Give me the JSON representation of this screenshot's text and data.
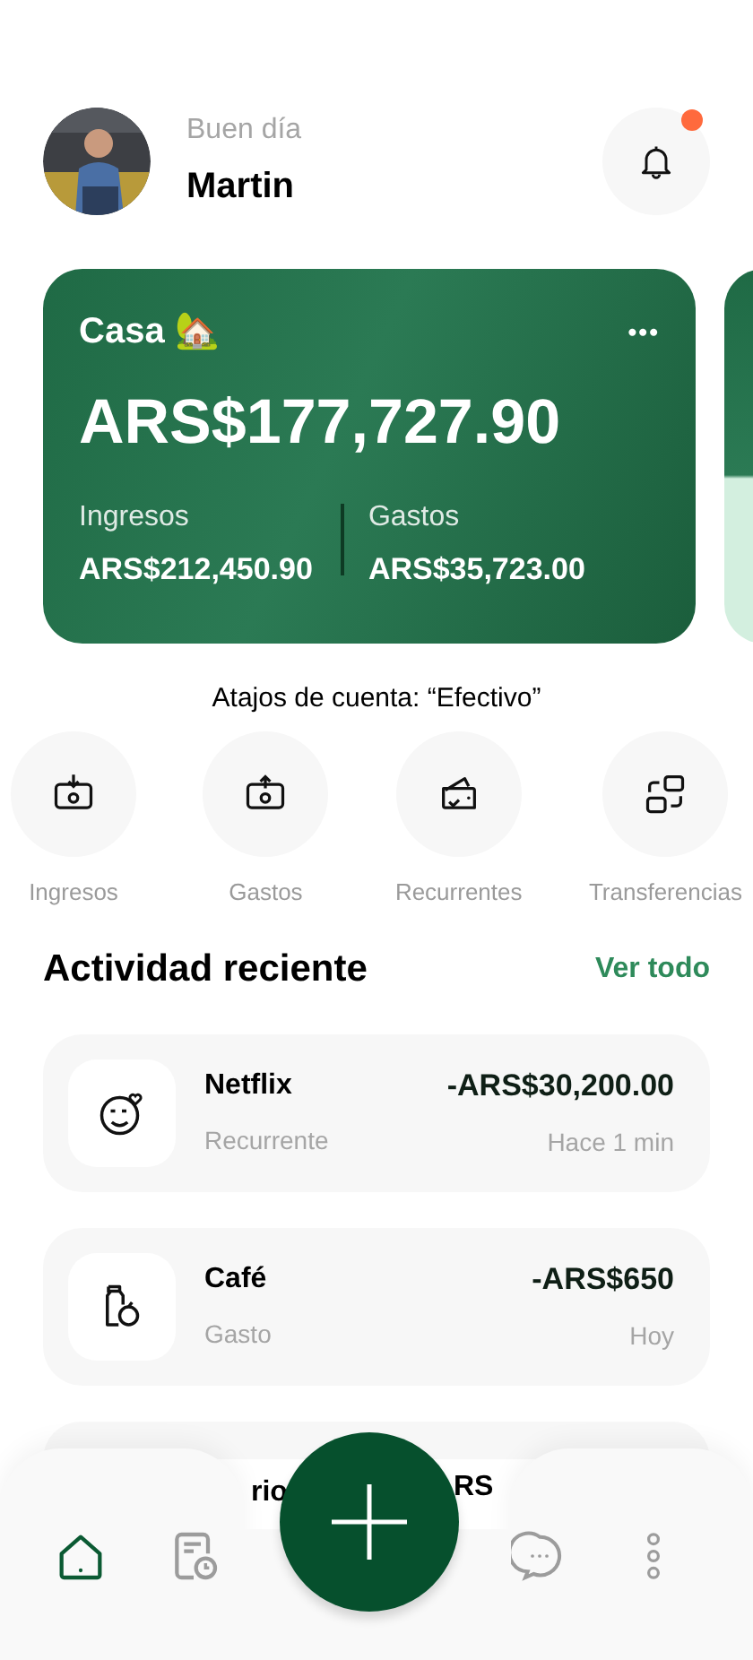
{
  "header": {
    "greeting": "Buen día",
    "user_name": "Martin",
    "notifications": {
      "unread": true
    }
  },
  "account_card": {
    "name": "Casa 🏡",
    "menu": "•••",
    "balance": "ARS$177,727.90",
    "income_label": "Ingresos",
    "income": "ARS$212,450.90",
    "expense_label": "Gastos",
    "expense": "ARS$35,723.00"
  },
  "shortcuts": {
    "title": "Atajos de cuenta: “Efectivo”",
    "items": [
      {
        "kind": "income",
        "label": "Ingresos"
      },
      {
        "kind": "expense",
        "label": "Gastos"
      },
      {
        "kind": "recurring",
        "label": "Recurrentes"
      },
      {
        "kind": "transfer",
        "label": "Transferencias"
      }
    ]
  },
  "activity": {
    "title": "Actividad reciente",
    "link": "Ver todo",
    "items": [
      {
        "kind": "subscription",
        "name": "Netflix",
        "category": "Recurrente",
        "amount": "-ARS$30,200.00",
        "time": "Hace 1 min"
      },
      {
        "kind": "food",
        "name": "Café",
        "category": "Gasto",
        "amount": "-ARS$650",
        "time": "Hoy"
      },
      {
        "kind": "partial",
        "name": "rio",
        "amount": "RS"
      }
    ]
  },
  "bottom_nav": {
    "items": [
      {
        "kind": "home",
        "selected": true
      },
      {
        "kind": "history",
        "selected": false
      },
      {
        "kind": "add"
      },
      {
        "kind": "chat",
        "selected": false
      },
      {
        "kind": "more",
        "selected": false
      }
    ]
  }
}
